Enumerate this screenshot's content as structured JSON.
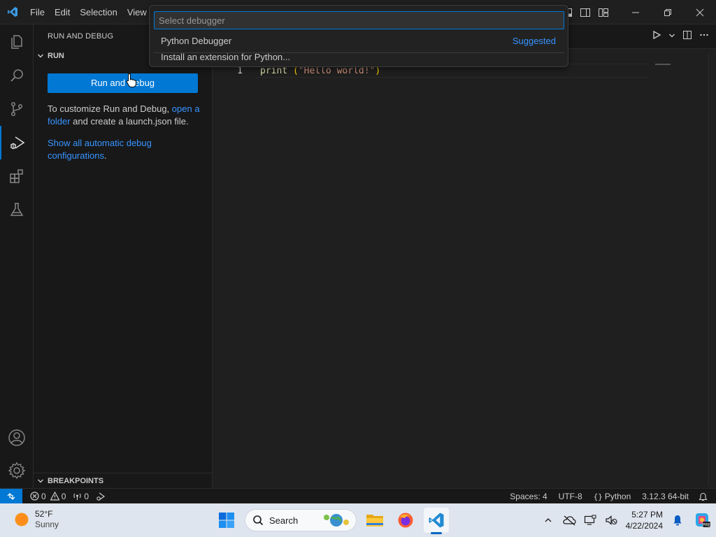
{
  "menu": [
    "File",
    "Edit",
    "Selection",
    "View"
  ],
  "sidebar": {
    "title": "RUN AND DEBUG",
    "run_section": "RUN",
    "run_button": "Run and Debug",
    "help_prefix": "To customize Run and Debug, ",
    "help_link": "open a folder",
    "help_suffix": " and create a launch.json file.",
    "show_all_link": "Show all automatic debug configurations",
    "show_all_suffix": ".",
    "breakpoints_section": "BREAKPOINTS"
  },
  "quickpick": {
    "placeholder": "Select debugger",
    "items": [
      {
        "label": "Python Debugger",
        "badge": "Suggested"
      },
      {
        "label": "Install an extension for Python..."
      }
    ]
  },
  "editor": {
    "line_number": "1",
    "code": {
      "fn": "print",
      "space": " ",
      "open": "(",
      "str": "\"Hello world!\"",
      "close": ")"
    }
  },
  "statusbar": {
    "errors": "0",
    "warnings": "0",
    "ports": "0",
    "spaces": "Spaces: 4",
    "encoding": "UTF-8",
    "language": "Python",
    "interpreter": "3.12.3 64-bit"
  },
  "taskbar": {
    "temperature": "52°F",
    "condition": "Sunny",
    "search": "Search",
    "time": "5:27 PM",
    "date": "4/22/2024"
  },
  "colors": {
    "accent": "#0078d4",
    "link": "#3794ff"
  }
}
